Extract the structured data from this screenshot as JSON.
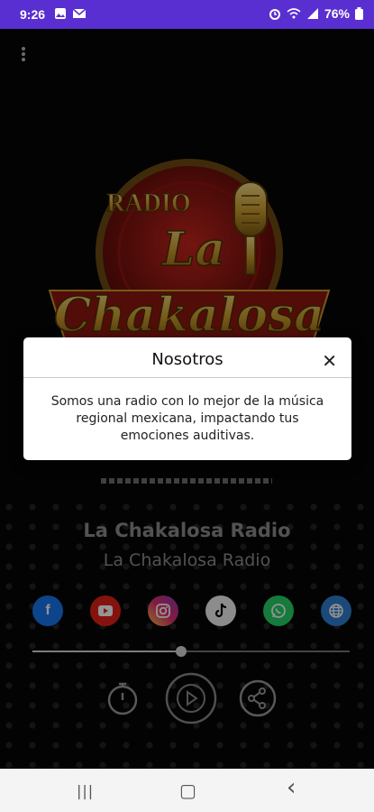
{
  "status_bar": {
    "time": "9:26",
    "battery": "76%",
    "icons": [
      "image-icon",
      "gmail-icon",
      "alarm-icon",
      "wifi-icon",
      "signal-icon",
      "battery-icon"
    ]
  },
  "app": {
    "menu_icon": "kebab-menu-icon",
    "logo": {
      "top_text": "RADIO",
      "middle_text": "La",
      "bottom_text": "Chakalosa"
    },
    "station": {
      "title": "La Chakalosa Radio",
      "subtitle": "La Chakalosa Radio"
    },
    "socials": [
      {
        "name": "facebook",
        "glyph": "f",
        "color": "#1877f2"
      },
      {
        "name": "youtube",
        "glyph": "▶",
        "color": "#e62117"
      },
      {
        "name": "instagram",
        "glyph": "◎",
        "color": "#d6249f"
      },
      {
        "name": "tiktok",
        "glyph": "♪",
        "color": "#ffffff"
      },
      {
        "name": "whatsapp",
        "glyph": "✆",
        "color": "#25d366"
      },
      {
        "name": "website",
        "glyph": "⊕",
        "color": "#2f7fd0"
      }
    ],
    "progress": 0.47,
    "controls": [
      "timer-icon",
      "play-icon",
      "share-icon"
    ]
  },
  "dialog": {
    "title": "Nosotros",
    "close_label": "✕",
    "body": "Somos una radio con lo mejor de la música regional mexicana, impactando tus emociones auditivas."
  },
  "nav_bar": {
    "recents": "|||",
    "home": "▢",
    "back": "‹"
  }
}
